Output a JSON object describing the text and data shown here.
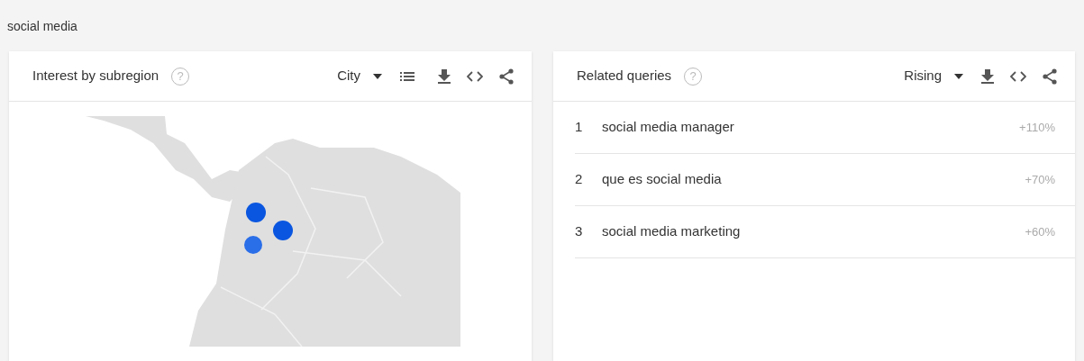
{
  "query_label": "social media",
  "interest_panel": {
    "title": "Interest by subregion",
    "help": "?",
    "dropdown": "City"
  },
  "related_panel": {
    "title": "Related queries",
    "help": "?",
    "dropdown": "Rising",
    "rows": [
      {
        "rank": "1",
        "query": "social media manager",
        "change": "+110%"
      },
      {
        "rank": "2",
        "query": "que es social media",
        "change": "+70%"
      },
      {
        "rank": "3",
        "query": "social media marketing",
        "change": "+60%"
      }
    ]
  }
}
